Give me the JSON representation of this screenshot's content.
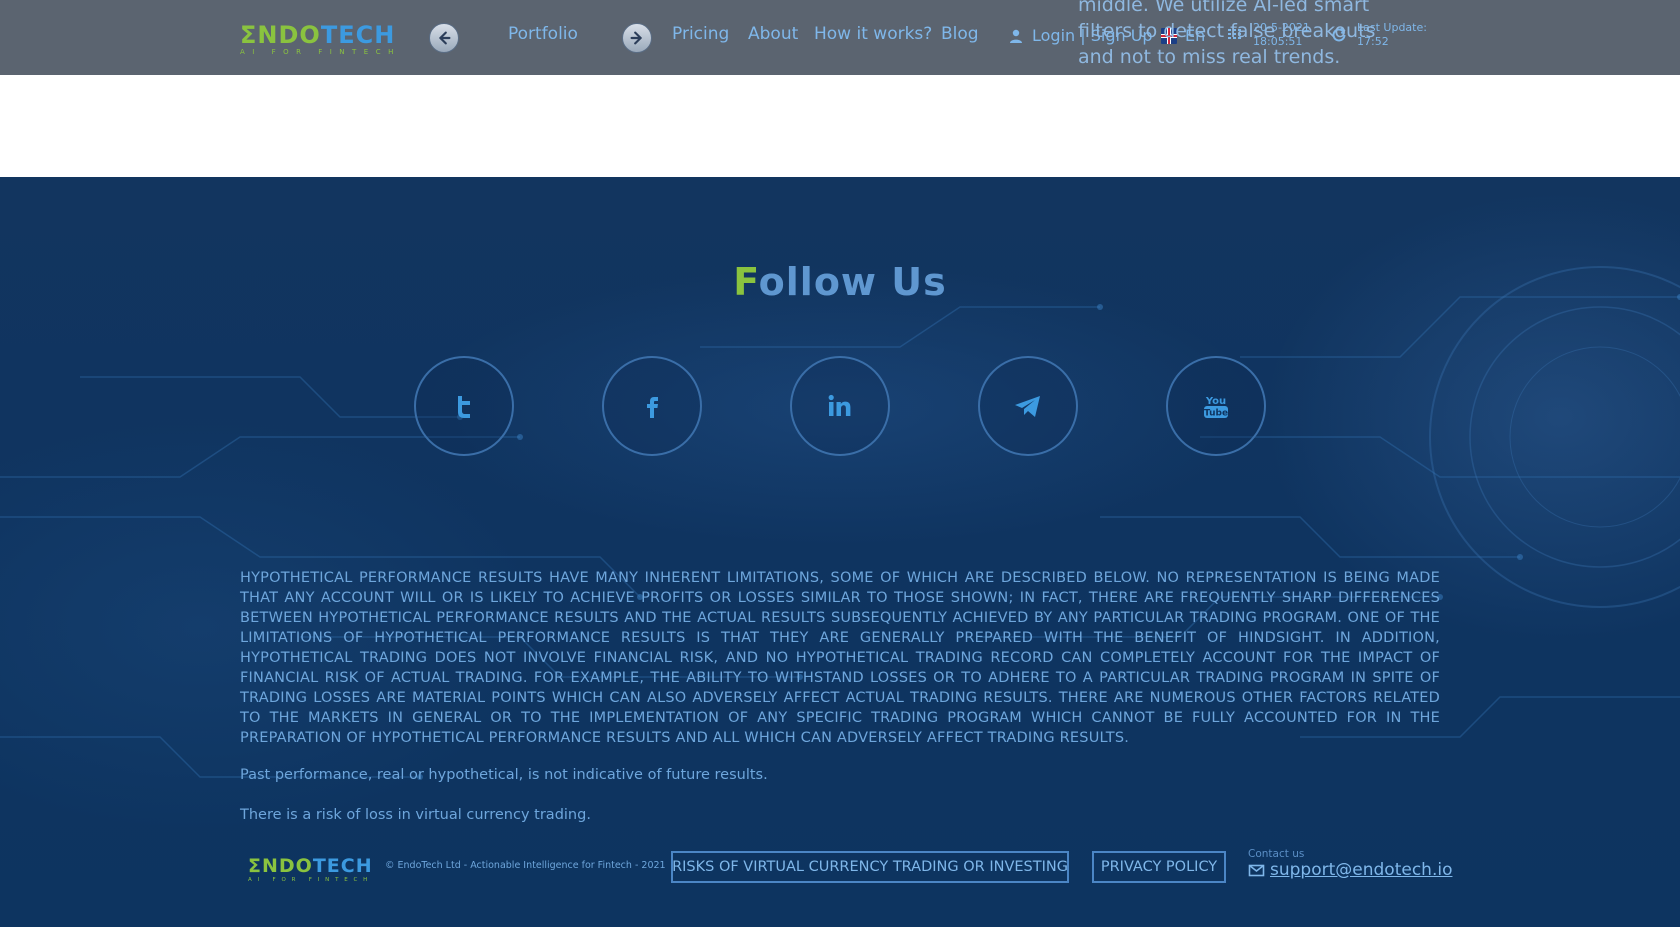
{
  "header": {
    "logo": {
      "word_first": "Σ",
      "word_green": "NDO",
      "word_blue": "TECH",
      "tagline": "AI FOR FINTECH"
    },
    "nav": {
      "portfolio": "Portfolio",
      "pricing": "Pricing",
      "about": "About",
      "how": "How it works?",
      "blog": "Blog"
    },
    "login": "Login | Sign Up",
    "language": "En",
    "date": "20-5-2021",
    "time": "18:05:51",
    "last_update_label": "Last Update:",
    "last_update_time": "17:52",
    "bleed_text": "middle. We utilize AI-led smart filters to detect false breakouts and not to miss real trends."
  },
  "footer": {
    "follow_first": "F",
    "follow_rest": "ollow Us",
    "social": [
      "twitter-icon",
      "facebook-icon",
      "linkedin-icon",
      "telegram-icon",
      "youtube-icon"
    ],
    "disclaimer": "HYPOTHETICAL PERFORMANCE RESULTS HAVE MANY INHERENT LIMITATIONS, SOME OF WHICH ARE DESCRIBED BELOW. NO REPRESENTATION IS BEING MADE THAT ANY ACCOUNT WILL OR IS LIKELY TO ACHIEVE PROFITS OR LOSSES SIMILAR TO THOSE SHOWN; IN FACT, THERE ARE FREQUENTLY SHARP DIFFERENCES BETWEEN HYPOTHETICAL PERFORMANCE RESULTS AND THE ACTUAL RESULTS SUBSEQUENTLY ACHIEVED BY ANY PARTICULAR TRADING PROGRAM. ONE OF THE LIMITATIONS OF HYPOTHETICAL PERFORMANCE RESULTS IS THAT THEY ARE GENERALLY PREPARED WITH THE BENEFIT OF HINDSIGHT. IN ADDITION, HYPOTHETICAL TRADING DOES NOT INVOLVE FINANCIAL RISK, AND NO HYPOTHETICAL TRADING RECORD CAN COMPLETELY ACCOUNT FOR THE IMPACT OF FINANCIAL RISK OF ACTUAL TRADING. FOR EXAMPLE, THE ABILITY TO WITHSTAND LOSSES OR TO ADHERE TO A PARTICULAR TRADING PROGRAM IN SPITE OF TRADING LOSSES ARE MATERIAL POINTS WHICH CAN ALSO ADVERSELY AFFECT ACTUAL TRADING RESULTS. THERE ARE NUMEROUS OTHER FACTORS RELATED TO THE MARKETS IN GENERAL OR TO THE IMPLEMENTATION OF ANY SPECIFIC TRADING PROGRAM WHICH CANNOT BE FULLY ACCOUNTED FOR IN THE PREPARATION OF HYPOTHETICAL PERFORMANCE RESULTS AND ALL WHICH CAN ADVERSELY AFFECT TRADING RESULTS.",
    "note_past": "Past performance, real or hypothetical, is not indicative of future results.",
    "note_risk": "There is a risk of loss in virtual currency trading.",
    "copyright": "© EndoTech Ltd - Actionable Intelligence for Fintech - 2021",
    "risks_button": "RISKS OF VIRTUAL CURRENCY TRADING OR INVESTING",
    "privacy_button": "PRIVACY POLICY",
    "contact_label": "Contact us",
    "contact_email": "support@endotech.io"
  },
  "colors": {
    "brand_green": "#8ac33f",
    "brand_blue": "#3c9ae0",
    "header_bg": "#5b6470",
    "footer_bg": "#0e3460",
    "link": "#7fb7ea"
  }
}
